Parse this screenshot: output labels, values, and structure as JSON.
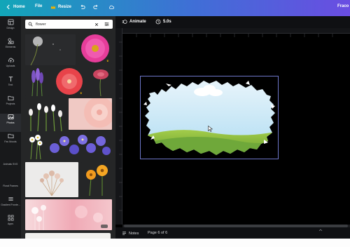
{
  "topbar": {
    "home_label": "Home",
    "file_label": "File",
    "resize_label": "Resize",
    "project_title": "Fraco"
  },
  "rail": {
    "items": [
      {
        "label": "Design",
        "icon": "layout-icon"
      },
      {
        "label": "Elements",
        "icon": "shapes-icon"
      },
      {
        "label": "Uploads",
        "icon": "cloud-upload-icon"
      },
      {
        "label": "Text",
        "icon": "text-icon"
      },
      {
        "label": "Projects",
        "icon": "folder-icon"
      },
      {
        "label": "Photos",
        "icon": "photo-icon"
      },
      {
        "label": "Fav Moods",
        "icon": "folder-icon"
      },
      {
        "label": "Animals SVG",
        "icon": "paw-icon"
      },
      {
        "label": "Floral Frames",
        "icon": "frame-icon"
      },
      {
        "label": "Gradient Fronte...",
        "icon": "gradient-icon"
      },
      {
        "label": "Apps",
        "icon": "apps-icon"
      }
    ]
  },
  "search": {
    "value": "flower"
  },
  "editor": {
    "animate_label": "Animate",
    "duration_label": "5.0s",
    "notes_label": "Notes",
    "page_label": "Page 6 of 6"
  },
  "colors": {
    "brand_teal": "#12a6b8",
    "brand_purple": "#6a4de2",
    "selection": "#6e77c9",
    "premium_crown": "#f2b300"
  }
}
